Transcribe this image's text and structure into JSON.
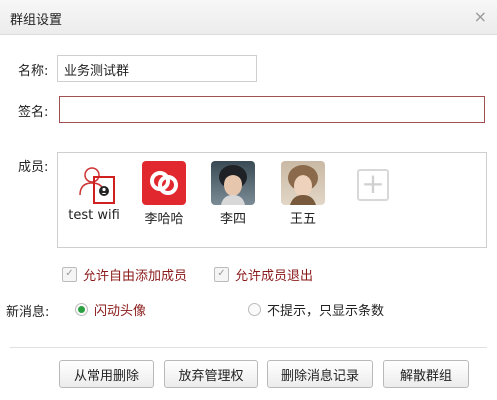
{
  "window": {
    "title": "群组设置",
    "close_glyph": "×"
  },
  "form": {
    "name_label": "名称:",
    "name_value": "业务测试群",
    "sign_label": "签名:",
    "sign_value": "",
    "members_label": "成员:"
  },
  "members": [
    {
      "name": "test wifi",
      "icon": "person-outline-icon"
    },
    {
      "name": "李哈哈",
      "icon": "app-logo-icon"
    },
    {
      "name": "李四",
      "icon": "avatar-photo"
    },
    {
      "name": "王五",
      "icon": "avatar-photo"
    }
  ],
  "add_member_glyph": "+",
  "options": {
    "allow_add": {
      "label": "允许自由添加成员",
      "checked": true,
      "check_glyph": "✓"
    },
    "allow_quit": {
      "label": "允许成员退出",
      "checked": true,
      "check_glyph": "✓"
    }
  },
  "new_message": {
    "label": "新消息:",
    "flash_avatar": {
      "label": "闪动头像",
      "selected": true
    },
    "show_count": {
      "label": "不提示，只显示条数",
      "selected": false
    }
  },
  "buttons": {
    "remove_common": "从常用删除",
    "give_up_admin": "放弃管理权",
    "delete_history": "删除消息记录",
    "dissolve": "解散群组"
  },
  "colors": {
    "accent_red": "#8b1a1a",
    "radio_green": "#2aa040",
    "app_red": "#e0282e"
  }
}
